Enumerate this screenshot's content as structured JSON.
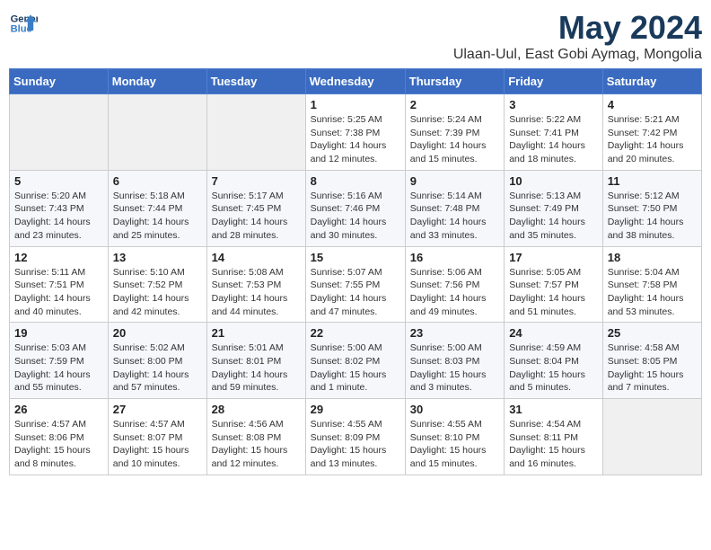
{
  "logo": {
    "line1": "General",
    "line2": "Blue"
  },
  "title": "May 2024",
  "location": "Ulaan-Uul, East Gobi Aymag, Mongolia",
  "weekdays": [
    "Sunday",
    "Monday",
    "Tuesday",
    "Wednesday",
    "Thursday",
    "Friday",
    "Saturday"
  ],
  "weeks": [
    [
      {
        "day": "",
        "info": ""
      },
      {
        "day": "",
        "info": ""
      },
      {
        "day": "",
        "info": ""
      },
      {
        "day": "1",
        "info": "Sunrise: 5:25 AM\nSunset: 7:38 PM\nDaylight: 14 hours\nand 12 minutes."
      },
      {
        "day": "2",
        "info": "Sunrise: 5:24 AM\nSunset: 7:39 PM\nDaylight: 14 hours\nand 15 minutes."
      },
      {
        "day": "3",
        "info": "Sunrise: 5:22 AM\nSunset: 7:41 PM\nDaylight: 14 hours\nand 18 minutes."
      },
      {
        "day": "4",
        "info": "Sunrise: 5:21 AM\nSunset: 7:42 PM\nDaylight: 14 hours\nand 20 minutes."
      }
    ],
    [
      {
        "day": "5",
        "info": "Sunrise: 5:20 AM\nSunset: 7:43 PM\nDaylight: 14 hours\nand 23 minutes."
      },
      {
        "day": "6",
        "info": "Sunrise: 5:18 AM\nSunset: 7:44 PM\nDaylight: 14 hours\nand 25 minutes."
      },
      {
        "day": "7",
        "info": "Sunrise: 5:17 AM\nSunset: 7:45 PM\nDaylight: 14 hours\nand 28 minutes."
      },
      {
        "day": "8",
        "info": "Sunrise: 5:16 AM\nSunset: 7:46 PM\nDaylight: 14 hours\nand 30 minutes."
      },
      {
        "day": "9",
        "info": "Sunrise: 5:14 AM\nSunset: 7:48 PM\nDaylight: 14 hours\nand 33 minutes."
      },
      {
        "day": "10",
        "info": "Sunrise: 5:13 AM\nSunset: 7:49 PM\nDaylight: 14 hours\nand 35 minutes."
      },
      {
        "day": "11",
        "info": "Sunrise: 5:12 AM\nSunset: 7:50 PM\nDaylight: 14 hours\nand 38 minutes."
      }
    ],
    [
      {
        "day": "12",
        "info": "Sunrise: 5:11 AM\nSunset: 7:51 PM\nDaylight: 14 hours\nand 40 minutes."
      },
      {
        "day": "13",
        "info": "Sunrise: 5:10 AM\nSunset: 7:52 PM\nDaylight: 14 hours\nand 42 minutes."
      },
      {
        "day": "14",
        "info": "Sunrise: 5:08 AM\nSunset: 7:53 PM\nDaylight: 14 hours\nand 44 minutes."
      },
      {
        "day": "15",
        "info": "Sunrise: 5:07 AM\nSunset: 7:55 PM\nDaylight: 14 hours\nand 47 minutes."
      },
      {
        "day": "16",
        "info": "Sunrise: 5:06 AM\nSunset: 7:56 PM\nDaylight: 14 hours\nand 49 minutes."
      },
      {
        "day": "17",
        "info": "Sunrise: 5:05 AM\nSunset: 7:57 PM\nDaylight: 14 hours\nand 51 minutes."
      },
      {
        "day": "18",
        "info": "Sunrise: 5:04 AM\nSunset: 7:58 PM\nDaylight: 14 hours\nand 53 minutes."
      }
    ],
    [
      {
        "day": "19",
        "info": "Sunrise: 5:03 AM\nSunset: 7:59 PM\nDaylight: 14 hours\nand 55 minutes."
      },
      {
        "day": "20",
        "info": "Sunrise: 5:02 AM\nSunset: 8:00 PM\nDaylight: 14 hours\nand 57 minutes."
      },
      {
        "day": "21",
        "info": "Sunrise: 5:01 AM\nSunset: 8:01 PM\nDaylight: 14 hours\nand 59 minutes."
      },
      {
        "day": "22",
        "info": "Sunrise: 5:00 AM\nSunset: 8:02 PM\nDaylight: 15 hours\nand 1 minute."
      },
      {
        "day": "23",
        "info": "Sunrise: 5:00 AM\nSunset: 8:03 PM\nDaylight: 15 hours\nand 3 minutes."
      },
      {
        "day": "24",
        "info": "Sunrise: 4:59 AM\nSunset: 8:04 PM\nDaylight: 15 hours\nand 5 minutes."
      },
      {
        "day": "25",
        "info": "Sunrise: 4:58 AM\nSunset: 8:05 PM\nDaylight: 15 hours\nand 7 minutes."
      }
    ],
    [
      {
        "day": "26",
        "info": "Sunrise: 4:57 AM\nSunset: 8:06 PM\nDaylight: 15 hours\nand 8 minutes."
      },
      {
        "day": "27",
        "info": "Sunrise: 4:57 AM\nSunset: 8:07 PM\nDaylight: 15 hours\nand 10 minutes."
      },
      {
        "day": "28",
        "info": "Sunrise: 4:56 AM\nSunset: 8:08 PM\nDaylight: 15 hours\nand 12 minutes."
      },
      {
        "day": "29",
        "info": "Sunrise: 4:55 AM\nSunset: 8:09 PM\nDaylight: 15 hours\nand 13 minutes."
      },
      {
        "day": "30",
        "info": "Sunrise: 4:55 AM\nSunset: 8:10 PM\nDaylight: 15 hours\nand 15 minutes."
      },
      {
        "day": "31",
        "info": "Sunrise: 4:54 AM\nSunset: 8:11 PM\nDaylight: 15 hours\nand 16 minutes."
      },
      {
        "day": "",
        "info": ""
      }
    ]
  ]
}
